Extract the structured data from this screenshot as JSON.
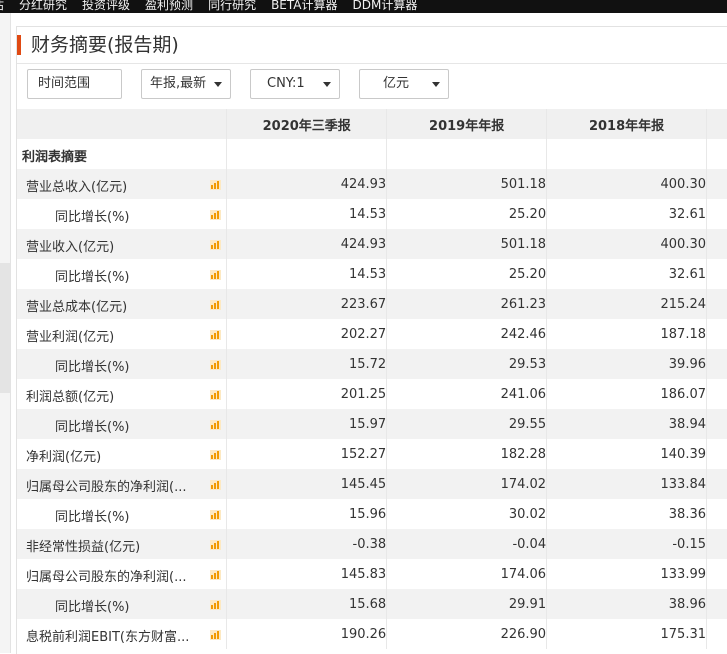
{
  "topnav": [
    "盈利预测评估",
    "分红研究",
    "投资评级",
    "盈利预测",
    "同行研究",
    "BETA计算器",
    "DDM计算器"
  ],
  "panel": {
    "title": "财务摘要(报告期)"
  },
  "filters": {
    "time_range": "时间范围",
    "report_type": "年报,最新",
    "currency": "CNY:1",
    "unit": "亿元"
  },
  "table": {
    "headers": [
      "",
      "2020年三季报",
      "2019年年报",
      "2018年年报"
    ],
    "section_title": "利润表摘要",
    "rows": [
      {
        "label": "营业总收入(亿元)",
        "indent": 0,
        "values": [
          "424.93",
          "501.18",
          "400.30"
        ]
      },
      {
        "label": "同比增长(%)",
        "indent": 1,
        "values": [
          "14.53",
          "25.20",
          "32.61"
        ]
      },
      {
        "label": "营业收入(亿元)",
        "indent": 0,
        "values": [
          "424.93",
          "501.18",
          "400.30"
        ]
      },
      {
        "label": "同比增长(%)",
        "indent": 1,
        "values": [
          "14.53",
          "25.20",
          "32.61"
        ]
      },
      {
        "label": "营业总成本(亿元)",
        "indent": 0,
        "values": [
          "223.67",
          "261.23",
          "215.24"
        ]
      },
      {
        "label": "营业利润(亿元)",
        "indent": 0,
        "values": [
          "202.27",
          "242.46",
          "187.18"
        ]
      },
      {
        "label": "同比增长(%)",
        "indent": 1,
        "values": [
          "15.72",
          "29.53",
          "39.96"
        ]
      },
      {
        "label": "利润总额(亿元)",
        "indent": 0,
        "values": [
          "201.25",
          "241.06",
          "186.07"
        ]
      },
      {
        "label": "同比增长(%)",
        "indent": 1,
        "values": [
          "15.97",
          "29.55",
          "38.94"
        ]
      },
      {
        "label": "净利润(亿元)",
        "indent": 0,
        "values": [
          "152.27",
          "182.28",
          "140.39"
        ]
      },
      {
        "label": "归属母公司股东的净利润(...",
        "indent": 0,
        "values": [
          "145.45",
          "174.02",
          "133.84"
        ]
      },
      {
        "label": "同比增长(%)",
        "indent": 1,
        "values": [
          "15.96",
          "30.02",
          "38.36"
        ]
      },
      {
        "label": "非经常性损益(亿元)",
        "indent": 0,
        "values": [
          "-0.38",
          "-0.04",
          "-0.15"
        ]
      },
      {
        "label": "归属母公司股东的净利润(...",
        "indent": 0,
        "values": [
          "145.83",
          "174.06",
          "133.99"
        ]
      },
      {
        "label": "同比增长(%)",
        "indent": 1,
        "values": [
          "15.68",
          "29.91",
          "38.96"
        ]
      },
      {
        "label": "息税前利润EBIT(东方财富...",
        "indent": 0,
        "values": [
          "190.26",
          "226.90",
          "175.31"
        ]
      }
    ]
  },
  "colors": {
    "accent": "#e04a13",
    "icon_orange": "#f29a00",
    "row_alt": "#f2f2f2",
    "header_bg": "#f0f0f0"
  }
}
